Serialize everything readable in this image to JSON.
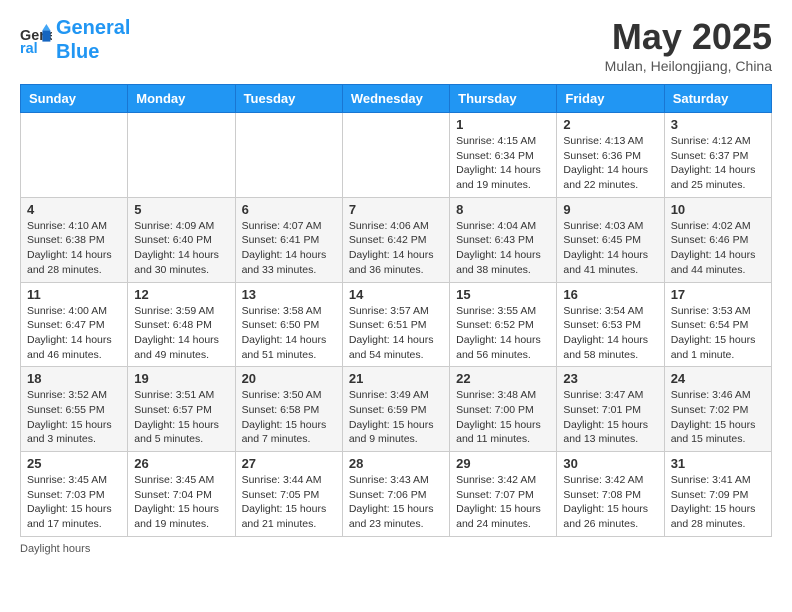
{
  "header": {
    "logo_line1": "General",
    "logo_line2": "Blue",
    "month_title": "May 2025",
    "location": "Mulan, Heilongjiang, China"
  },
  "days_of_week": [
    "Sunday",
    "Monday",
    "Tuesday",
    "Wednesday",
    "Thursday",
    "Friday",
    "Saturday"
  ],
  "weeks": [
    [
      {
        "day": "",
        "info": ""
      },
      {
        "day": "",
        "info": ""
      },
      {
        "day": "",
        "info": ""
      },
      {
        "day": "",
        "info": ""
      },
      {
        "day": "1",
        "info": "Sunrise: 4:15 AM\nSunset: 6:34 PM\nDaylight: 14 hours\nand 19 minutes."
      },
      {
        "day": "2",
        "info": "Sunrise: 4:13 AM\nSunset: 6:36 PM\nDaylight: 14 hours\nand 22 minutes."
      },
      {
        "day": "3",
        "info": "Sunrise: 4:12 AM\nSunset: 6:37 PM\nDaylight: 14 hours\nand 25 minutes."
      }
    ],
    [
      {
        "day": "4",
        "info": "Sunrise: 4:10 AM\nSunset: 6:38 PM\nDaylight: 14 hours\nand 28 minutes."
      },
      {
        "day": "5",
        "info": "Sunrise: 4:09 AM\nSunset: 6:40 PM\nDaylight: 14 hours\nand 30 minutes."
      },
      {
        "day": "6",
        "info": "Sunrise: 4:07 AM\nSunset: 6:41 PM\nDaylight: 14 hours\nand 33 minutes."
      },
      {
        "day": "7",
        "info": "Sunrise: 4:06 AM\nSunset: 6:42 PM\nDaylight: 14 hours\nand 36 minutes."
      },
      {
        "day": "8",
        "info": "Sunrise: 4:04 AM\nSunset: 6:43 PM\nDaylight: 14 hours\nand 38 minutes."
      },
      {
        "day": "9",
        "info": "Sunrise: 4:03 AM\nSunset: 6:45 PM\nDaylight: 14 hours\nand 41 minutes."
      },
      {
        "day": "10",
        "info": "Sunrise: 4:02 AM\nSunset: 6:46 PM\nDaylight: 14 hours\nand 44 minutes."
      }
    ],
    [
      {
        "day": "11",
        "info": "Sunrise: 4:00 AM\nSunset: 6:47 PM\nDaylight: 14 hours\nand 46 minutes."
      },
      {
        "day": "12",
        "info": "Sunrise: 3:59 AM\nSunset: 6:48 PM\nDaylight: 14 hours\nand 49 minutes."
      },
      {
        "day": "13",
        "info": "Sunrise: 3:58 AM\nSunset: 6:50 PM\nDaylight: 14 hours\nand 51 minutes."
      },
      {
        "day": "14",
        "info": "Sunrise: 3:57 AM\nSunset: 6:51 PM\nDaylight: 14 hours\nand 54 minutes."
      },
      {
        "day": "15",
        "info": "Sunrise: 3:55 AM\nSunset: 6:52 PM\nDaylight: 14 hours\nand 56 minutes."
      },
      {
        "day": "16",
        "info": "Sunrise: 3:54 AM\nSunset: 6:53 PM\nDaylight: 14 hours\nand 58 minutes."
      },
      {
        "day": "17",
        "info": "Sunrise: 3:53 AM\nSunset: 6:54 PM\nDaylight: 15 hours\nand 1 minute."
      }
    ],
    [
      {
        "day": "18",
        "info": "Sunrise: 3:52 AM\nSunset: 6:55 PM\nDaylight: 15 hours\nand 3 minutes."
      },
      {
        "day": "19",
        "info": "Sunrise: 3:51 AM\nSunset: 6:57 PM\nDaylight: 15 hours\nand 5 minutes."
      },
      {
        "day": "20",
        "info": "Sunrise: 3:50 AM\nSunset: 6:58 PM\nDaylight: 15 hours\nand 7 minutes."
      },
      {
        "day": "21",
        "info": "Sunrise: 3:49 AM\nSunset: 6:59 PM\nDaylight: 15 hours\nand 9 minutes."
      },
      {
        "day": "22",
        "info": "Sunrise: 3:48 AM\nSunset: 7:00 PM\nDaylight: 15 hours\nand 11 minutes."
      },
      {
        "day": "23",
        "info": "Sunrise: 3:47 AM\nSunset: 7:01 PM\nDaylight: 15 hours\nand 13 minutes."
      },
      {
        "day": "24",
        "info": "Sunrise: 3:46 AM\nSunset: 7:02 PM\nDaylight: 15 hours\nand 15 minutes."
      }
    ],
    [
      {
        "day": "25",
        "info": "Sunrise: 3:45 AM\nSunset: 7:03 PM\nDaylight: 15 hours\nand 17 minutes."
      },
      {
        "day": "26",
        "info": "Sunrise: 3:45 AM\nSunset: 7:04 PM\nDaylight: 15 hours\nand 19 minutes."
      },
      {
        "day": "27",
        "info": "Sunrise: 3:44 AM\nSunset: 7:05 PM\nDaylight: 15 hours\nand 21 minutes."
      },
      {
        "day": "28",
        "info": "Sunrise: 3:43 AM\nSunset: 7:06 PM\nDaylight: 15 hours\nand 23 minutes."
      },
      {
        "day": "29",
        "info": "Sunrise: 3:42 AM\nSunset: 7:07 PM\nDaylight: 15 hours\nand 24 minutes."
      },
      {
        "day": "30",
        "info": "Sunrise: 3:42 AM\nSunset: 7:08 PM\nDaylight: 15 hours\nand 26 minutes."
      },
      {
        "day": "31",
        "info": "Sunrise: 3:41 AM\nSunset: 7:09 PM\nDaylight: 15 hours\nand 28 minutes."
      }
    ]
  ],
  "footer": {
    "daylight_label": "Daylight hours"
  }
}
